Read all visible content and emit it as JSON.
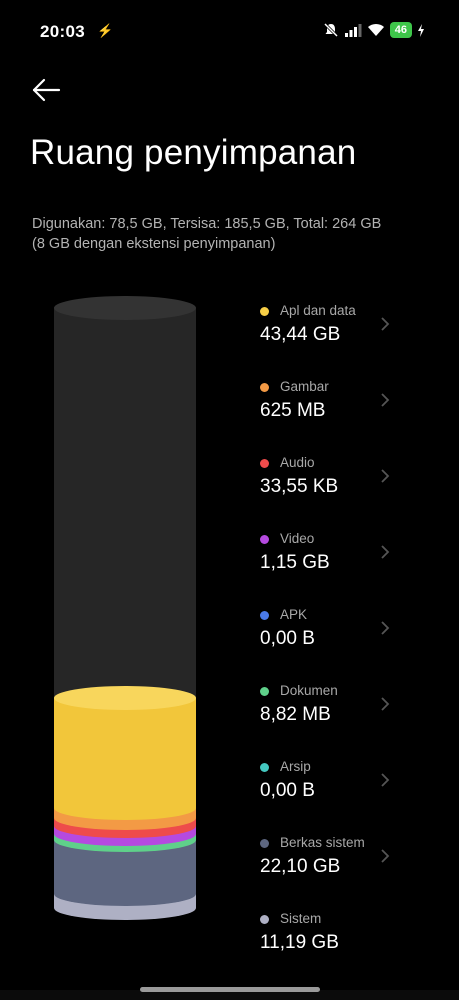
{
  "status_bar": {
    "time": "20:03",
    "charging_glyph": "⚡",
    "battery_level": "46",
    "icons": [
      "mute-icon",
      "signal-icon",
      "wifi-icon",
      "battery-icon",
      "charging-icon"
    ]
  },
  "header": {
    "back_icon": "arrow-left-icon",
    "title": "Ruang penyimpanan"
  },
  "summary": {
    "line1": "Digunakan: 78,5 GB, Tersisa: 185,5 GB, Total: 264 GB",
    "line2": "(8 GB dengan ekstensi penyimpanan)"
  },
  "categories": [
    {
      "name": "Apl dan data",
      "size": "43,44 GB",
      "color": "#f7cf47"
    },
    {
      "name": "Gambar",
      "size": "625 MB",
      "color": "#f39a45"
    },
    {
      "name": "Audio",
      "size": "33,55 KB",
      "color": "#ee4b4b"
    },
    {
      "name": "Video",
      "size": "1,15 GB",
      "color": "#b54ae0"
    },
    {
      "name": "APK",
      "size": "0,00 B",
      "color": "#4a7ae8"
    },
    {
      "name": "Dokumen",
      "size": "8,82 MB",
      "color": "#5fd08a"
    },
    {
      "name": "Arsip",
      "size": "0,00 B",
      "color": "#44c8c0"
    },
    {
      "name": "Berkas sistem",
      "size": "22,10 GB",
      "color": "#5d6680"
    },
    {
      "name": "Sistem",
      "size": "11,19 GB",
      "color": "#aeb0c4"
    }
  ],
  "colors": {
    "background": "#000000",
    "cylinder_empty": "#2a2a2a",
    "secondary_text": "#a8a8a8"
  }
}
